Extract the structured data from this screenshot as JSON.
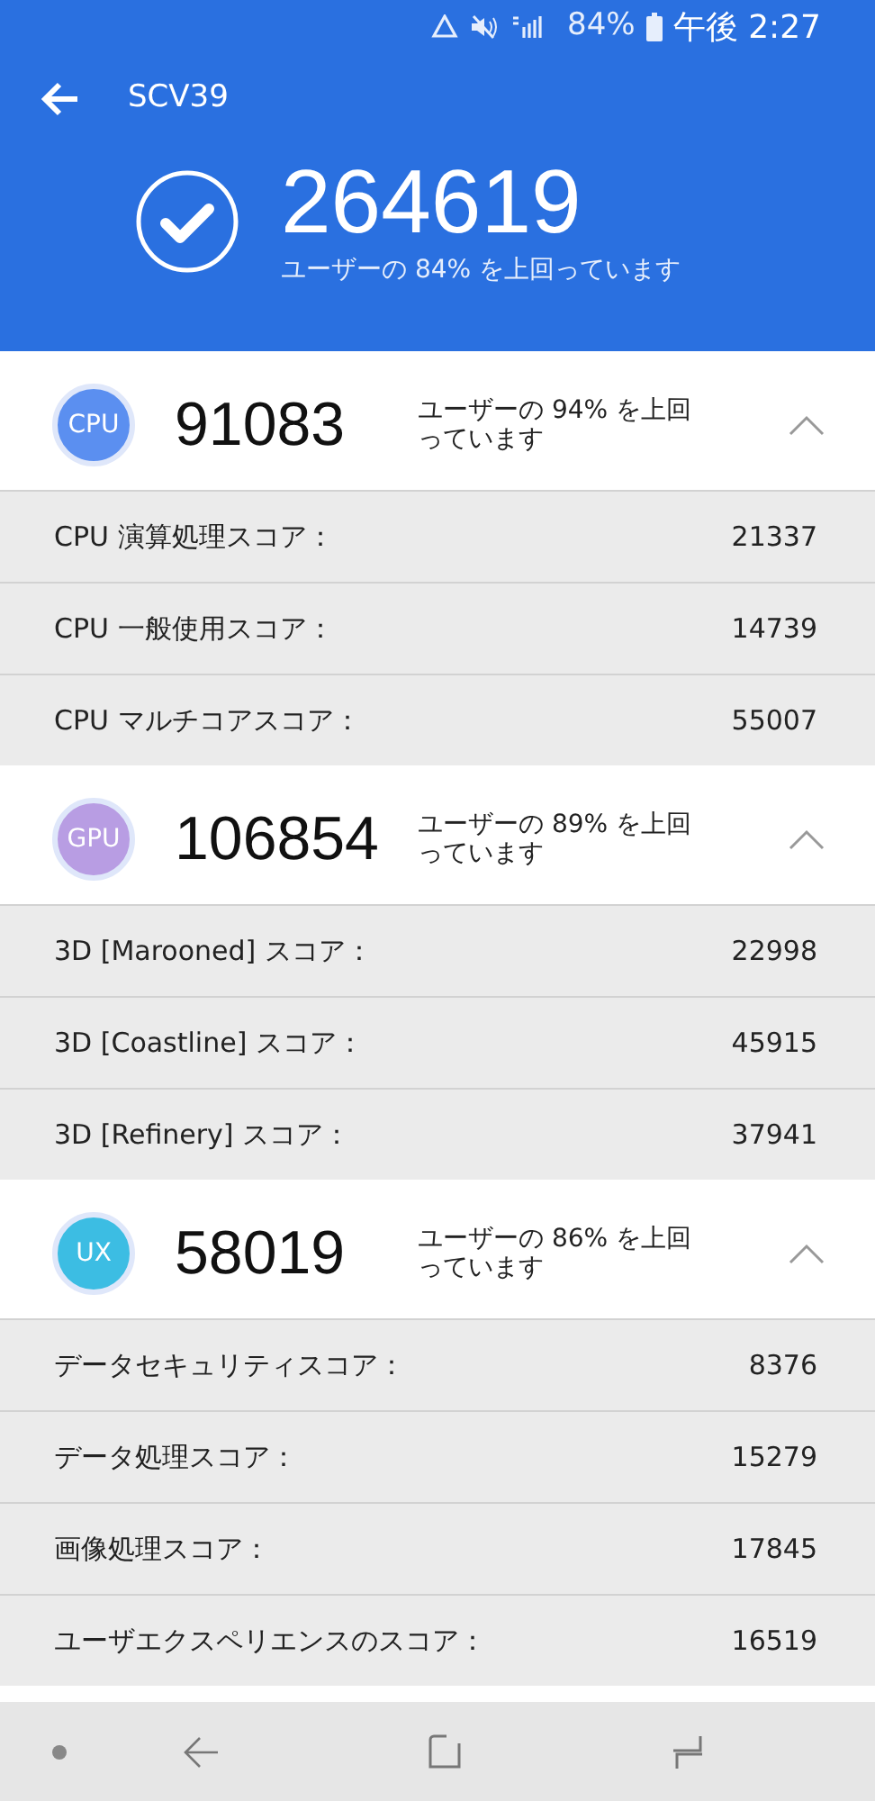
{
  "status_bar": {
    "battery": "84%",
    "time": "午後 2:27"
  },
  "header": {
    "title": "SCV39",
    "total_score": "264619",
    "percentile_text": "ユーザーの 84% を上回っています"
  },
  "sections": [
    {
      "icon_label": "CPU",
      "color": "#5b8ff0",
      "score": "91083",
      "percentile_text": "ユーザーの 94% を上回っています",
      "expanded": true,
      "rows": [
        {
          "label": "CPU 演算処理スコア：",
          "value": "21337"
        },
        {
          "label": "CPU 一般使用スコア：",
          "value": "14739"
        },
        {
          "label": "CPU マルチコアスコア：",
          "value": "55007"
        }
      ]
    },
    {
      "icon_label": "GPU",
      "color": "#b89de3",
      "score": "106854",
      "percentile_text": "ユーザーの 89% を上回っています",
      "expanded": true,
      "rows": [
        {
          "label": "3D [Marooned] スコア：",
          "value": "22998"
        },
        {
          "label": "3D [Coastline] スコア：",
          "value": "45915"
        },
        {
          "label": "3D [Refinery] スコア：",
          "value": "37941"
        }
      ]
    },
    {
      "icon_label": "UX",
      "color": "#3cbde3",
      "score": "58019",
      "percentile_text": "ユーザーの 86% を上回っています",
      "expanded": true,
      "rows": [
        {
          "label": "データセキュリティスコア：",
          "value": "8376"
        },
        {
          "label": "データ処理スコア：",
          "value": "15279"
        },
        {
          "label": "画像処理スコア：",
          "value": "17845"
        },
        {
          "label": "ユーザエクスペリエンスのスコア：",
          "value": "16519"
        }
      ]
    }
  ]
}
